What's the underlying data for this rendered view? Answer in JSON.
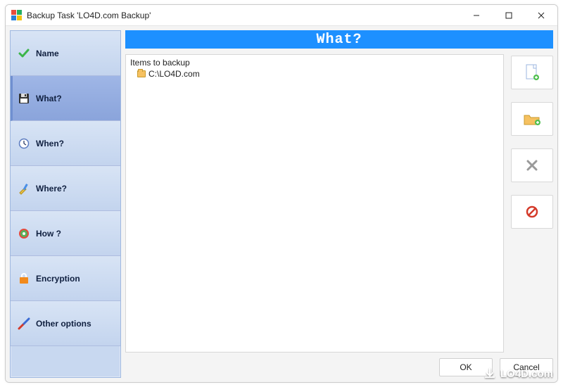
{
  "window": {
    "title": "Backup Task 'LO4D.com Backup'"
  },
  "sidebar": {
    "items": [
      {
        "label": "Name",
        "icon": "check-icon",
        "selected": false
      },
      {
        "label": "What?",
        "icon": "floppy-icon",
        "selected": true
      },
      {
        "label": "When?",
        "icon": "clock-icon",
        "selected": false
      },
      {
        "label": "Where?",
        "icon": "tools-icon",
        "selected": false
      },
      {
        "label": "How ?",
        "icon": "disc-icon",
        "selected": false
      },
      {
        "label": "Encryption",
        "icon": "lock-icon",
        "selected": false
      },
      {
        "label": "Other options",
        "icon": "wrench-icon",
        "selected": false
      }
    ]
  },
  "page": {
    "header": "What?"
  },
  "items_panel": {
    "header": "Items to backup",
    "entries": [
      {
        "path": "C:\\LO4D.com"
      }
    ]
  },
  "actions": {
    "add_file": "add-file",
    "add_folder": "add-folder",
    "remove": "remove",
    "clear": "clear"
  },
  "buttons": {
    "ok": "OK",
    "cancel": "Cancel"
  },
  "watermark": "LO4D.com"
}
